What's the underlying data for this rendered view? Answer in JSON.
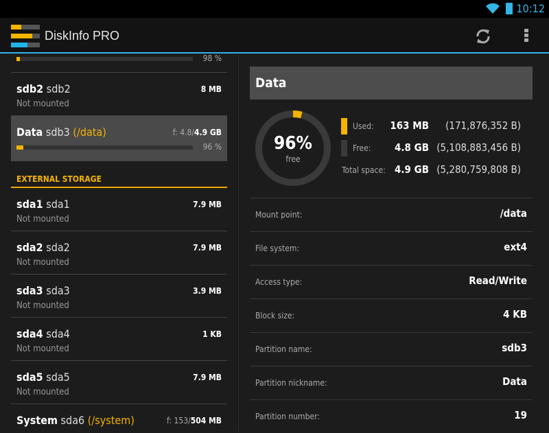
{
  "status": {
    "time": "10:12"
  },
  "app": {
    "title": "DiskInfo PRO"
  },
  "colors": {
    "accent": "#33b5e5",
    "used": "#f5b400"
  },
  "list": {
    "top_partial": {
      "percent_label": "98 %",
      "used_fraction": 0.02
    },
    "sdb2": {
      "nick": "sdb2",
      "name": "sdb2",
      "status": "Not mounted",
      "size": "8 MB"
    },
    "data": {
      "nick": "Data",
      "name": "sdb3",
      "mount": "(/data)",
      "free": "f: 4.8/",
      "total": "4.9 GB",
      "percent_label": "96 %",
      "used_fraction": 0.04
    },
    "external_header": "EXTERNAL STORAGE",
    "external": [
      {
        "nick": "sda1",
        "name": "sda1",
        "status": "Not mounted",
        "size": "7.9 MB"
      },
      {
        "nick": "sda2",
        "name": "sda2",
        "status": "Not mounted",
        "size": "7.9 MB"
      },
      {
        "nick": "sda3",
        "name": "sda3",
        "status": "Not mounted",
        "size": "3.9 MB"
      },
      {
        "nick": "sda4",
        "name": "sda4",
        "status": "Not mounted",
        "size": "1 KB"
      },
      {
        "nick": "sda5",
        "name": "sda5",
        "status": "Not mounted",
        "size": "7.9 MB"
      }
    ],
    "system": {
      "nick": "System",
      "name": "sda6",
      "mount": "(/system)",
      "free": "f: 153/",
      "total": "504 MB"
    }
  },
  "detail": {
    "title": "Data",
    "free_percent": "96%",
    "free_label": "free",
    "used_fraction": 0.04,
    "used_label": "Used:",
    "used_value": "163 MB",
    "used_bytes": "(171,876,352 B)",
    "free_label2": "Free:",
    "free_value": "4.8 GB",
    "free_bytes": "(5,108,883,456 B)",
    "total_label": "Total space:",
    "total_value": "4.9 GB",
    "total_bytes": "(5,280,759,808 B)",
    "rows": [
      {
        "k": "Mount point:",
        "v": "/data"
      },
      {
        "k": "File system:",
        "v": "ext4"
      },
      {
        "k": "Access type:",
        "v": "Read/Write"
      },
      {
        "k": "Block size:",
        "v": "4 KB"
      },
      {
        "k": "Partition name:",
        "v": "sdb3"
      },
      {
        "k": "Partition nickname:",
        "v": "Data"
      },
      {
        "k": "Partition number:",
        "v": "19"
      }
    ]
  }
}
